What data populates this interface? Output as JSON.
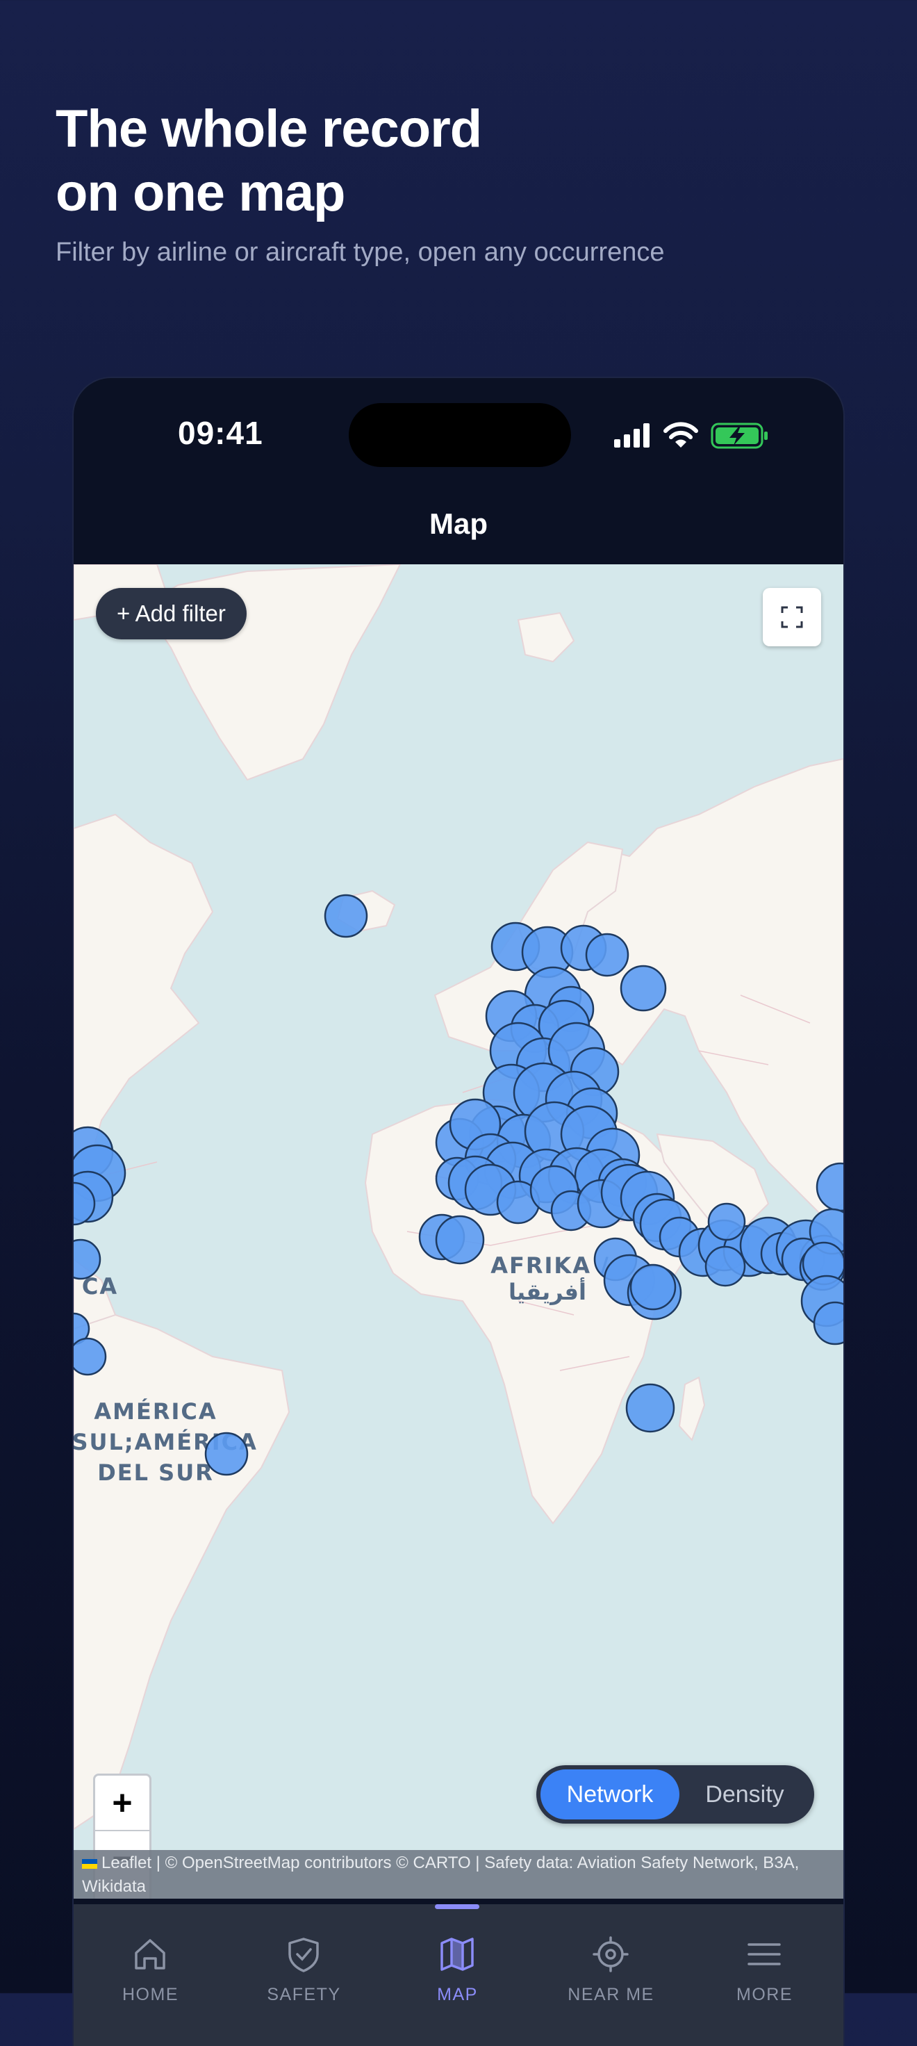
{
  "promo": {
    "headline_line1": "The whole record",
    "headline_line2": "on one map",
    "subline": "Filter by airline or aircraft type, open any occurrence"
  },
  "status_bar": {
    "time": "09:41",
    "battery_color": "#34c759"
  },
  "nav": {
    "title": "Map"
  },
  "map": {
    "add_filter_label": "+ Add filter",
    "fullscreen_icon": "fullscreen-corners-icon",
    "zoom_in": "+",
    "zoom_out": "−",
    "region_labels": {
      "africa_line1": "AFRIKA /",
      "africa_line2": "أفريقيا",
      "south_america_line1": "AMÉRICA",
      "south_america_line2": "O SUL;AMÉRICA",
      "south_america_line3": "DEL SUR",
      "america_fragment": "CA"
    },
    "mode_toggle": {
      "options": [
        "Network",
        "Density"
      ],
      "selected": "Network"
    },
    "attribution": {
      "leaflet": "Leaflet",
      "text": "| © OpenStreetMap contributors © CARTO | Safety data: Aviation Safety Network, B3A, Wikidata"
    },
    "marker_color": "#5b9bf2",
    "water_color": "#d5e8eb",
    "land_color": "#f8f5f0"
  },
  "tabbar": {
    "items": [
      {
        "label": "HOME",
        "icon": "house-icon"
      },
      {
        "label": "SAFETY",
        "icon": "shield-check-icon"
      },
      {
        "label": "MAP",
        "icon": "map-icon"
      },
      {
        "label": "NEAR ME",
        "icon": "crosshair-icon"
      },
      {
        "label": "MORE",
        "icon": "menu-lines-icon"
      }
    ],
    "active": "MAP",
    "active_color": "#8b8cf8"
  }
}
